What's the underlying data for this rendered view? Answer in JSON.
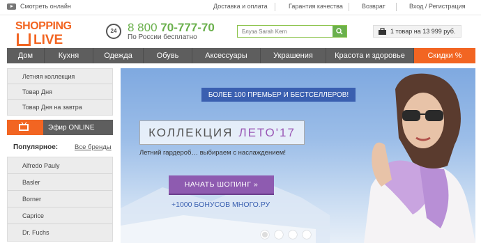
{
  "topbar": {
    "watch_online": "Смотреть онлайн",
    "links": [
      "Доставка и оплата",
      "Гарантия качества",
      "Возврат",
      "Вход / Регистрация"
    ]
  },
  "logo": {
    "line1": "SHOPPING",
    "line2": "LIVE"
  },
  "contact": {
    "icon_text": "24",
    "phone_prefix": "8 800",
    "phone_number": "70-777-70",
    "phone_note": "По России бесплатно"
  },
  "search": {
    "value": "",
    "placeholder": "Блуза Sarah Kern"
  },
  "cart": {
    "label": "1 товар на 13 999 руб."
  },
  "nav": {
    "items": [
      "Дом",
      "Кухня",
      "Одежда",
      "Обувь",
      "Аксессуары",
      "Украшения",
      "Красота и здоровье"
    ],
    "sale": "Скидки %"
  },
  "sidebar": {
    "items": [
      "Летняя коллекция",
      "Товар Дня",
      "Товар Дня на завтра"
    ],
    "live_label": "Эфир ONLINE",
    "popular_title": "Популярное:",
    "all_brands": "Все бренды",
    "brands": [
      "Alfredo Pauly",
      "Basler",
      "Borner",
      "Caprice",
      "Dr. Fuchs"
    ]
  },
  "hero": {
    "top_banner": "БОЛЕЕ 100 ПРЕМЬЕР И БЕСТСЕЛЛЕРОВ!",
    "collection": "КОЛЛЕКЦИЯ",
    "collection_accent": "ЛЕТО'17",
    "subtitle": "Летний гардероб… выбираем с наслаждением!",
    "button": "НАЧАТЬ ШОПИНГ »",
    "bonus": "+1000 БОНУСОВ МНОГО.РУ"
  },
  "colors": {
    "brand": "#f26522",
    "green": "#6ab04c",
    "nav": "#5e5e5e",
    "purple": "#8e5bb0",
    "blue": "#3a5fb0"
  }
}
